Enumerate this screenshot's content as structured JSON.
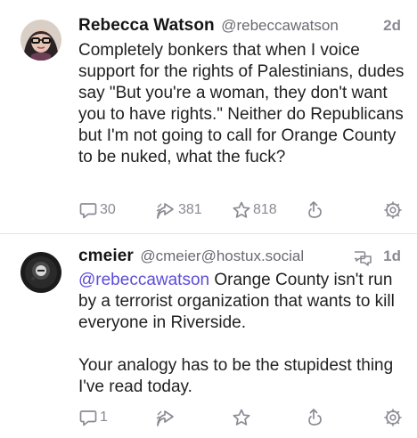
{
  "posts": [
    {
      "display_name": "Rebecca Watson",
      "handle": "@rebeccawatson",
      "time": "2d",
      "content": [
        "Completely bonkers that when I voice support for the rights of Palestinians, dudes say \"But you're a woman, they don't want you to have rights.\" Neither do Republicans but I'm not going to call for Orange County to be nuked, what the fuck?"
      ],
      "replies": "30",
      "boosts": "381",
      "favourites": "818",
      "icons": {
        "reply": "reply-icon",
        "boost": "boost-icon",
        "favourite": "star-icon",
        "share": "share-icon",
        "more": "gear-icon"
      }
    },
    {
      "display_name": "cmeier",
      "handle": "@cmeier@hostux.social",
      "time": "1d",
      "status_icon": "reply-thread-icon",
      "mention": "@rebeccawatson",
      "content": [
        " Orange County isn't run by a terrorist organization that wants to kill everyone in Riverside.",
        "Your analogy has to be the stupidest thing I've read today."
      ],
      "replies": "1",
      "boosts": "",
      "favourites": "",
      "icons": {
        "reply": "reply-icon",
        "boost": "boost-icon",
        "favourite": "star-icon",
        "share": "share-icon",
        "more": "gear-icon"
      }
    }
  ],
  "colors": {
    "mention": "#5c4cd8",
    "muted": "#8a8a94",
    "divider": "#e3e3e8"
  }
}
